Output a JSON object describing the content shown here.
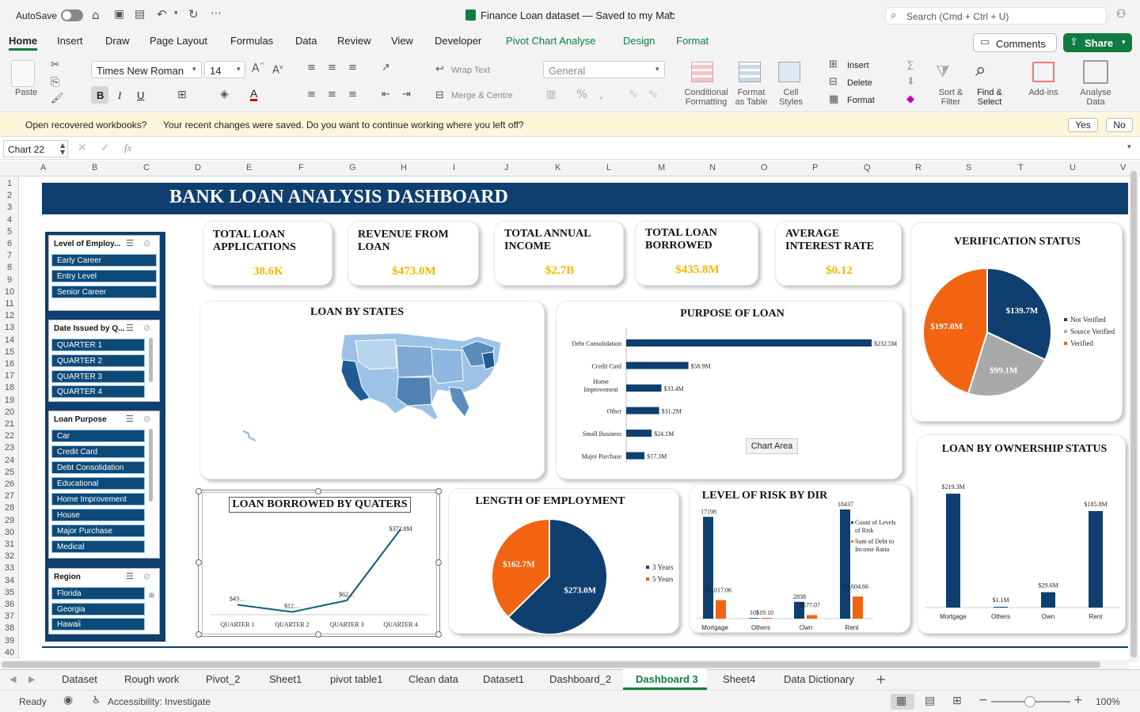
{
  "titlebar": {
    "autosave": "AutoSave",
    "doc_title": "Finance Loan dataset — Saved to my Mac",
    "search_placeholder": "Search (Cmd + Ctrl + U)"
  },
  "ribbon_tabs": [
    "Home",
    "Insert",
    "Draw",
    "Page Layout",
    "Formulas",
    "Data",
    "Review",
    "View",
    "Developer",
    "Pivot Chart Analyse",
    "Design",
    "Format"
  ],
  "ribbon": {
    "comments": "Comments",
    "share": "Share",
    "paste": "Paste",
    "font_name": "Times New Roman",
    "font_size": "14",
    "wrap_text": "Wrap Text",
    "merge_centre": "Merge & Centre",
    "number_format": "General",
    "conditional_formatting": "Conditional Formatting",
    "format_as_table": "Format as Table",
    "cell_styles": "Cell Styles",
    "insert": "Insert",
    "delete": "Delete",
    "format": "Format",
    "sort_filter": "Sort & Filter",
    "find_select": "Find & Select",
    "add_ins": "Add-ins",
    "analyse_data": "Analyse Data"
  },
  "notice": {
    "title": "Open recovered workbooks?",
    "message": "Your recent changes were saved. Do you want to continue working where you left off?",
    "yes": "Yes",
    "no": "No"
  },
  "formula_bar": {
    "name_box": "Chart 22",
    "fx": "fx"
  },
  "columns": [
    "A",
    "B",
    "C",
    "D",
    "E",
    "F",
    "G",
    "H",
    "I",
    "J",
    "K",
    "L",
    "M",
    "N",
    "O",
    "P",
    "Q",
    "R",
    "S",
    "T",
    "U",
    "V"
  ],
  "rows": [
    "1",
    "2",
    "3",
    "4",
    "5",
    "6",
    "7",
    "8",
    "9",
    "10",
    "11",
    "12",
    "13",
    "14",
    "15",
    "16",
    "17",
    "18",
    "19",
    "20",
    "21",
    "22",
    "23",
    "24",
    "25",
    "26",
    "27",
    "28",
    "29",
    "30",
    "31",
    "32",
    "33",
    "34",
    "35",
    "36",
    "37",
    "38",
    "39",
    "40"
  ],
  "dashboard": {
    "title": "BANK LOAN ANALYSIS DASHBOARD",
    "kpis": [
      {
        "label": "TOTAL LOAN APPLICATIONS",
        "value": "38.6K"
      },
      {
        "label": "REVENUE FROM LOAN",
        "value": "$473.0M"
      },
      {
        "label": "TOTAL ANNUAL INCOME",
        "value": "$2.7B"
      },
      {
        "label": "TOTAL LOAN BORROWED",
        "value": "$435.8M"
      },
      {
        "label": "AVERAGE INTEREST RATE",
        "value": "$0.12"
      }
    ],
    "slicers": [
      {
        "title": "Level of Employ...",
        "items": [
          "Early Career",
          "Entry Level",
          "Senior Career"
        ]
      },
      {
        "title": "Date Issued by Q...",
        "items": [
          "QUARTER 1",
          "QUARTER 2",
          "QUARTER 3",
          "QUARTER 4"
        ]
      },
      {
        "title": "Loan Purpose",
        "items": [
          "Car",
          "Credit Card",
          "Debt Consolidation",
          "Educational",
          "Home Improvement",
          "House",
          "Major Purchase",
          "Medical"
        ]
      },
      {
        "title": "Region",
        "items": [
          "Florida",
          "Georgia",
          "Hawaii"
        ]
      }
    ],
    "chart_area_tooltip": "Chart Area"
  },
  "chart_data": [
    {
      "type": "pie",
      "title": "VERIFICATION STATUS",
      "categories": [
        "Not Verified",
        "Source Verified",
        "Verified"
      ],
      "values": [
        139.7,
        99.1,
        197.0
      ],
      "labels": [
        "$139.7M",
        "$99.1M",
        "$197.0M"
      ],
      "colors": [
        "#0e3f6e",
        "#a9a9a9",
        "#f26411"
      ],
      "legend": "right"
    },
    {
      "type": "bar",
      "orientation": "horizontal",
      "title": "PURPOSE OF LOAN",
      "categories": [
        "Debt Consolidation",
        "Credit Card",
        "Home Improvement",
        "Other",
        "Small Business",
        "Major Purchase"
      ],
      "values": [
        232.5,
        58.9,
        33.4,
        31.2,
        24.1,
        17.3
      ],
      "labels": [
        "$232.5M",
        "$58.9M",
        "$33.4M",
        "$31.2M",
        "$24.1M",
        "$17.3M"
      ]
    },
    {
      "type": "line",
      "title": "LOAN BORROWED BY QUATERS",
      "categories": [
        "QUARTER 1",
        "QUARTER 2",
        "QUARTER 3",
        "QUARTER 4"
      ],
      "values": [
        43,
        12,
        62,
        372.8
      ],
      "labels": [
        "$43…",
        "$12…",
        "$62…",
        "$372.8M"
      ]
    },
    {
      "type": "pie",
      "title": "LENGTH OF EMPLOYMENT",
      "categories": [
        "3 Years",
        "5 Years"
      ],
      "values": [
        273.0,
        162.7
      ],
      "labels": [
        "$273.0M",
        "$162.7M"
      ],
      "colors": [
        "#0e3f6e",
        "#f26411"
      ],
      "legend": "right"
    },
    {
      "type": "bar",
      "title": "LEVEL OF RISK BY DIR",
      "categories": [
        "Mortgage",
        "Others",
        "Own",
        "Rent"
      ],
      "series": [
        {
          "name": "Count of Levels of Risk",
          "values": [
            17198,
            101,
            2838,
            18437
          ],
          "labels": [
            "17198",
            "101",
            "2838",
            "18437"
          ]
        },
        {
          "name": "Sum of Debt to Income Ratio",
          "values": [
            3017.06,
            19.1,
            577.07,
            3604.66
          ],
          "labels": [
            "$3,017.06",
            "$19.10",
            "$577.07",
            "$3,604.66"
          ]
        }
      ],
      "legend": "right"
    },
    {
      "type": "bar",
      "title": "LOAN BY OWNERSHIP STATUS",
      "categories": [
        "Mortgage",
        "Others",
        "Own",
        "Rent"
      ],
      "values": [
        219.3,
        1.1,
        29.6,
        185.8
      ],
      "labels": [
        "$219.3M",
        "$1.1M",
        "$29.6M",
        "$185.8M"
      ]
    }
  ],
  "map": {
    "title": "LOAN BY STATES"
  },
  "sheets": [
    "Dataset",
    "Rough work",
    "Pivot_2",
    "Sheet1",
    "pivot table1",
    "Clean data",
    "Dataset1",
    "Dashboard_2",
    "Dashboard 3",
    "Sheet4",
    "Data Dictionary"
  ],
  "active_sheet": "Dashboard 3",
  "status": {
    "ready": "Ready",
    "accessibility": "Accessibility: Investigate",
    "zoom": "100%"
  }
}
